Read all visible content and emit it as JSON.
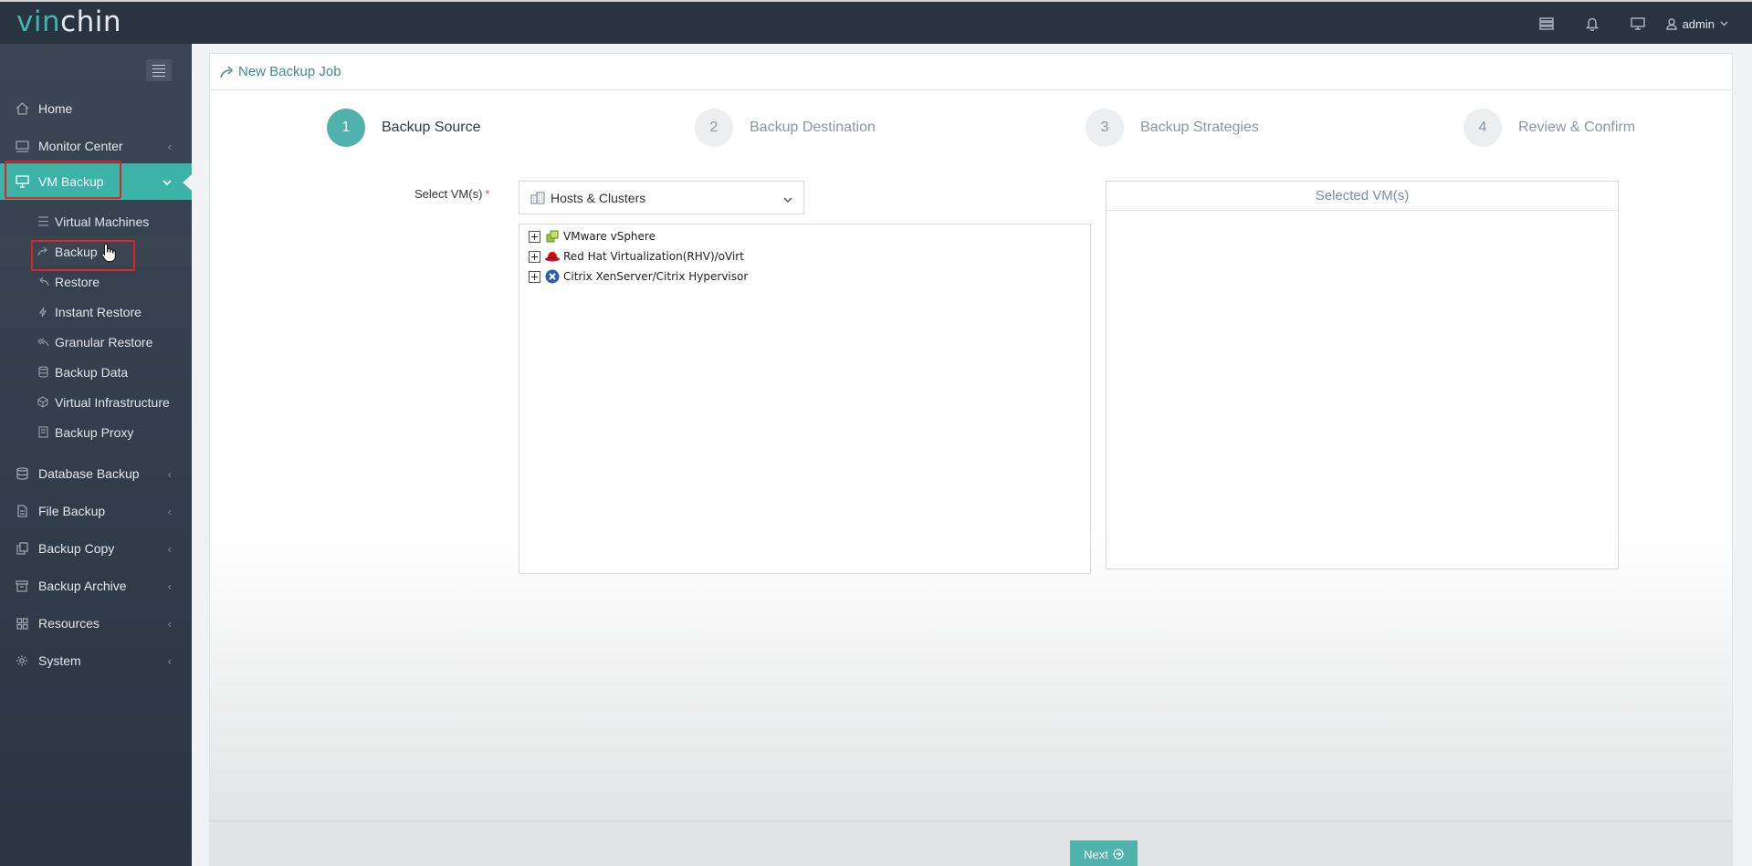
{
  "brand": {
    "logo_part1": "vin",
    "logo_part2": "chin"
  },
  "topbar": {
    "user_label": "admin"
  },
  "sidebar": {
    "items": [
      {
        "label": "Home"
      },
      {
        "label": "Monitor Center"
      },
      {
        "label": "VM Backup",
        "active": true
      },
      {
        "label": "Database Backup"
      },
      {
        "label": "File Backup"
      },
      {
        "label": "Backup Copy"
      },
      {
        "label": "Backup Archive"
      },
      {
        "label": "Resources"
      },
      {
        "label": "System"
      }
    ],
    "vm_backup_subitems": [
      {
        "label": "Virtual Machines"
      },
      {
        "label": "Backup",
        "current": true
      },
      {
        "label": "Restore"
      },
      {
        "label": "Instant Restore"
      },
      {
        "label": "Granular Restore"
      },
      {
        "label": "Backup Data"
      },
      {
        "label": "Virtual Infrastructure"
      },
      {
        "label": "Backup Proxy"
      }
    ]
  },
  "page": {
    "title": "New Backup Job",
    "steps": [
      {
        "number": "1",
        "label": "Backup Source",
        "state": "current"
      },
      {
        "number": "2",
        "label": "Backup Destination",
        "state": "pending"
      },
      {
        "number": "3",
        "label": "Backup Strategies",
        "state": "pending"
      },
      {
        "number": "4",
        "label": "Review & Confirm",
        "state": "pending"
      }
    ],
    "select_vms_label": "Select VM(s)",
    "required_mark": "*",
    "view_dropdown": {
      "value": "Hosts & Clusters"
    },
    "tree": [
      {
        "label": "VMware vSphere",
        "icon": "vmware-icon"
      },
      {
        "label": "Red Hat Virtualization(RHV)/oVirt",
        "icon": "redhat-icon"
      },
      {
        "label": "Citrix XenServer/Citrix Hypervisor",
        "icon": "citrix-icon"
      }
    ],
    "selected_vms_title": "Selected VM(s)",
    "next_label": "Next"
  },
  "colors": {
    "accent": "#4fb3ab",
    "topbar": "#283440",
    "sidebar": "#353f4c",
    "highlight_box": "#e02424"
  }
}
